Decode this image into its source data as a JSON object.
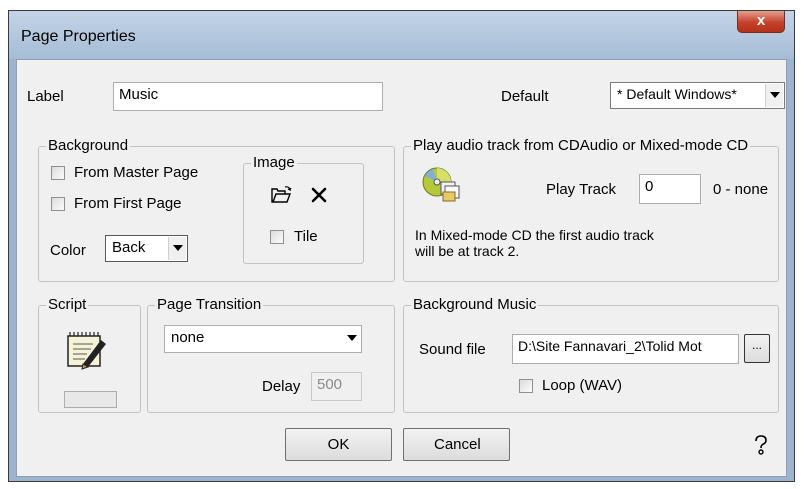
{
  "window": {
    "title": "Page Properties",
    "close_glyph": "x"
  },
  "label_row": {
    "label": "Label",
    "value": "Music",
    "default_label": "Default",
    "default_value": "* Default Windows*"
  },
  "background": {
    "title": "Background",
    "from_master": "From Master Page",
    "from_first": "From First Page",
    "color_label": "Color",
    "color_value": "Back",
    "image_title": "Image",
    "tile": "Tile"
  },
  "audio": {
    "title": "Play audio track from CDAudio or Mixed-mode CD",
    "play_track_label": "Play Track",
    "play_track_value": "0",
    "none_hint": "0  - none",
    "note_line1": "In Mixed-mode CD the first audio track",
    "note_line2": "will be at track 2."
  },
  "script": {
    "title": "Script"
  },
  "transition": {
    "title": "Page Transition",
    "value": "none",
    "delay_label": "Delay",
    "delay_value": "500"
  },
  "music": {
    "title": "Background Music",
    "sound_file_label": "Sound file",
    "sound_file_value": "D:\\Site Fannavari_2\\Tolid Mot",
    "browse_label": "...",
    "loop_label": "Loop (WAV)"
  },
  "buttons": {
    "ok": "OK",
    "cancel": "Cancel",
    "help": "?"
  },
  "icons": {
    "close": "close-icon",
    "cd": "cd-icon",
    "open_folder": "open-folder-icon",
    "delete": "delete-x-icon",
    "script": "script-notepad-icon",
    "help": "help-icon"
  }
}
